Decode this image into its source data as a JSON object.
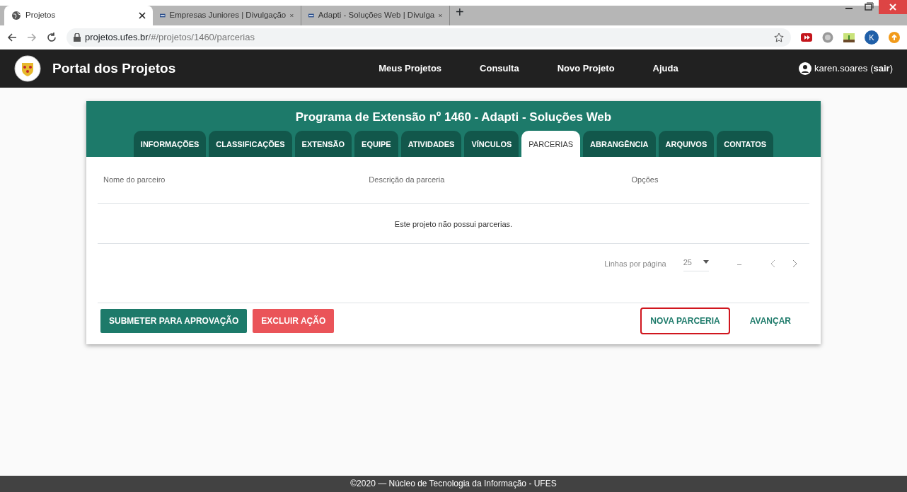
{
  "browser": {
    "tabs": [
      {
        "label": "Projetos",
        "selected": true
      },
      {
        "label": "Empresas Juniores | Divulgação",
        "selected": false
      },
      {
        "label": "Adapti - Soluções Web | Divulga",
        "selected": false
      }
    ],
    "new_tab": "+",
    "url_host": "projetos.ufes.br",
    "url_path": "/#/projetos/1460/parcerias",
    "profile_initial": "K"
  },
  "navbar": {
    "brand": "Portal dos Projetos",
    "links": [
      "Meus Projetos",
      "Consulta",
      "Novo Projeto",
      "Ajuda"
    ],
    "user": "karen.soares",
    "paren_open": "(",
    "logout": "sair",
    "paren_close": ")"
  },
  "card": {
    "title": "Programa de Extensão nº 1460 - Adapti - Soluções Web",
    "tabs": [
      {
        "label": "INFORMAÇÕES",
        "selected": false
      },
      {
        "label": "CLASSIFICAÇÕES",
        "selected": false
      },
      {
        "label": "EXTENSÃO",
        "selected": false
      },
      {
        "label": "EQUIPE",
        "selected": false
      },
      {
        "label": "ATIVIDADES",
        "selected": false
      },
      {
        "label": "VÍNCULOS",
        "selected": false
      },
      {
        "label": "PARCERIAS",
        "selected": true
      },
      {
        "label": "ABRANGÊNCIA",
        "selected": false
      },
      {
        "label": "ARQUIVOS",
        "selected": false
      },
      {
        "label": "CONTATOS",
        "selected": false
      }
    ],
    "table": {
      "columns": [
        "Nome do parceiro",
        "Descrição da parceria",
        "Opções"
      ],
      "empty_message": "Este projeto não possui parcerias."
    },
    "pagination": {
      "rows_label": "Linhas por página",
      "rows_value": "25",
      "range": "–"
    },
    "actions": [
      {
        "label": "SUBMETER PARA APROVAÇÃO",
        "kind": "primary",
        "highlighted": false
      },
      {
        "label": "EXCLUIR AÇÃO",
        "kind": "danger",
        "highlighted": false
      },
      {
        "label": "NOVA PARCERIA",
        "kind": "text",
        "highlighted": true
      },
      {
        "label": "AVANÇAR",
        "kind": "text",
        "highlighted": false
      }
    ]
  },
  "footer": "©2020 — Núcleo de Tecnologia da Informação - UFES"
}
